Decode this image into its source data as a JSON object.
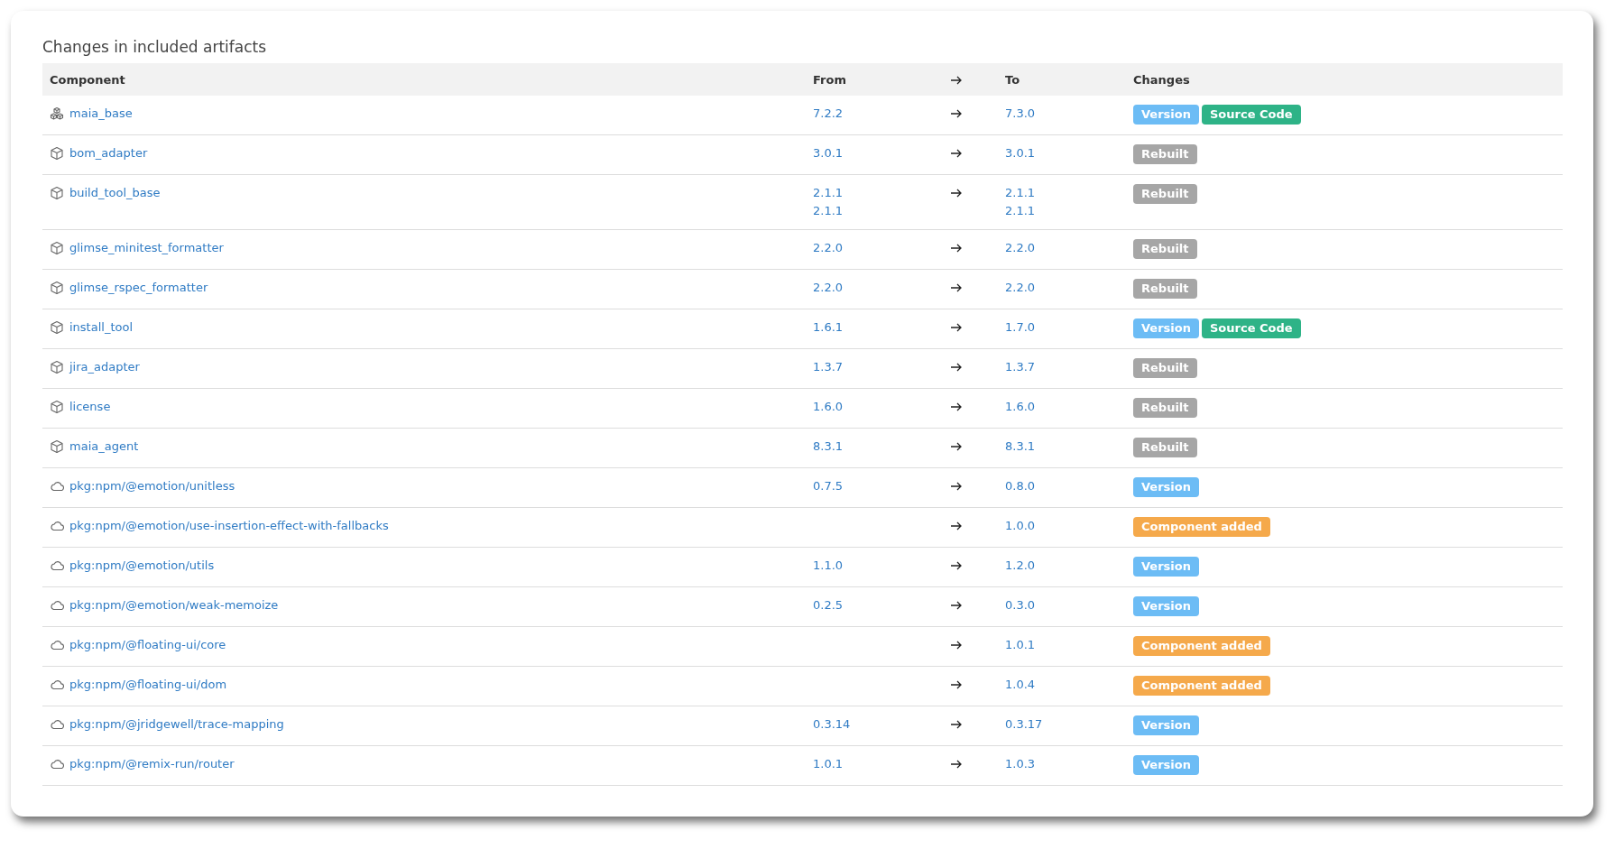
{
  "title": "Changes in included artifacts",
  "table": {
    "columns": [
      "Component",
      "From",
      "To",
      "Changes"
    ],
    "rows": [
      {
        "kind": "group",
        "name": "maia_base",
        "from": [
          "7.2.2"
        ],
        "to": [
          "7.3.0"
        ],
        "changes": [
          {
            "kind": "version",
            "label": "Version"
          },
          {
            "kind": "source",
            "label": "Source Code"
          }
        ]
      },
      {
        "kind": "package",
        "name": "bom_adapter",
        "from": [
          "3.0.1"
        ],
        "to": [
          "3.0.1"
        ],
        "changes": [
          {
            "kind": "rebuilt",
            "label": "Rebuilt"
          }
        ]
      },
      {
        "kind": "package",
        "name": "build_tool_base",
        "from": [
          "2.1.1",
          "2.1.1"
        ],
        "to": [
          "2.1.1",
          "2.1.1"
        ],
        "changes": [
          {
            "kind": "rebuilt",
            "label": "Rebuilt"
          }
        ]
      },
      {
        "kind": "package",
        "name": "glimse_minitest_formatter",
        "from": [
          "2.2.0"
        ],
        "to": [
          "2.2.0"
        ],
        "changes": [
          {
            "kind": "rebuilt",
            "label": "Rebuilt"
          }
        ]
      },
      {
        "kind": "package",
        "name": "glimse_rspec_formatter",
        "from": [
          "2.2.0"
        ],
        "to": [
          "2.2.0"
        ],
        "changes": [
          {
            "kind": "rebuilt",
            "label": "Rebuilt"
          }
        ]
      },
      {
        "kind": "package",
        "name": "install_tool",
        "from": [
          "1.6.1"
        ],
        "to": [
          "1.7.0"
        ],
        "changes": [
          {
            "kind": "version",
            "label": "Version"
          },
          {
            "kind": "source",
            "label": "Source Code"
          }
        ]
      },
      {
        "kind": "package",
        "name": "jira_adapter",
        "from": [
          "1.3.7"
        ],
        "to": [
          "1.3.7"
        ],
        "changes": [
          {
            "kind": "rebuilt",
            "label": "Rebuilt"
          }
        ]
      },
      {
        "kind": "package",
        "name": "license",
        "from": [
          "1.6.0"
        ],
        "to": [
          "1.6.0"
        ],
        "changes": [
          {
            "kind": "rebuilt",
            "label": "Rebuilt"
          }
        ]
      },
      {
        "kind": "package",
        "name": "maia_agent",
        "from": [
          "8.3.1"
        ],
        "to": [
          "8.3.1"
        ],
        "changes": [
          {
            "kind": "rebuilt",
            "label": "Rebuilt"
          }
        ]
      },
      {
        "kind": "cloud",
        "name": "pkg:npm/@emotion/unitless",
        "from": [
          "0.7.5"
        ],
        "to": [
          "0.8.0"
        ],
        "changes": [
          {
            "kind": "version",
            "label": "Version"
          }
        ]
      },
      {
        "kind": "cloud",
        "name": "pkg:npm/@emotion/use-insertion-effect-with-fallbacks",
        "from": [],
        "to": [
          "1.0.0"
        ],
        "changes": [
          {
            "kind": "added",
            "label": "Component added"
          }
        ]
      },
      {
        "kind": "cloud",
        "name": "pkg:npm/@emotion/utils",
        "from": [
          "1.1.0"
        ],
        "to": [
          "1.2.0"
        ],
        "changes": [
          {
            "kind": "version",
            "label": "Version"
          }
        ]
      },
      {
        "kind": "cloud",
        "name": "pkg:npm/@emotion/weak-memoize",
        "from": [
          "0.2.5"
        ],
        "to": [
          "0.3.0"
        ],
        "changes": [
          {
            "kind": "version",
            "label": "Version"
          }
        ]
      },
      {
        "kind": "cloud",
        "name": "pkg:npm/@floating-ui/core",
        "from": [],
        "to": [
          "1.0.1"
        ],
        "changes": [
          {
            "kind": "added",
            "label": "Component added"
          }
        ]
      },
      {
        "kind": "cloud",
        "name": "pkg:npm/@floating-ui/dom",
        "from": [],
        "to": [
          "1.0.4"
        ],
        "changes": [
          {
            "kind": "added",
            "label": "Component added"
          }
        ]
      },
      {
        "kind": "cloud",
        "name": "pkg:npm/@jridgewell/trace-mapping",
        "from": [
          "0.3.14"
        ],
        "to": [
          "0.3.17"
        ],
        "changes": [
          {
            "kind": "version",
            "label": "Version"
          }
        ]
      },
      {
        "kind": "cloud",
        "name": "pkg:npm/@remix-run/router",
        "from": [
          "1.0.1"
        ],
        "to": [
          "1.0.3"
        ],
        "changes": [
          {
            "kind": "version",
            "label": "Version"
          }
        ]
      }
    ]
  }
}
